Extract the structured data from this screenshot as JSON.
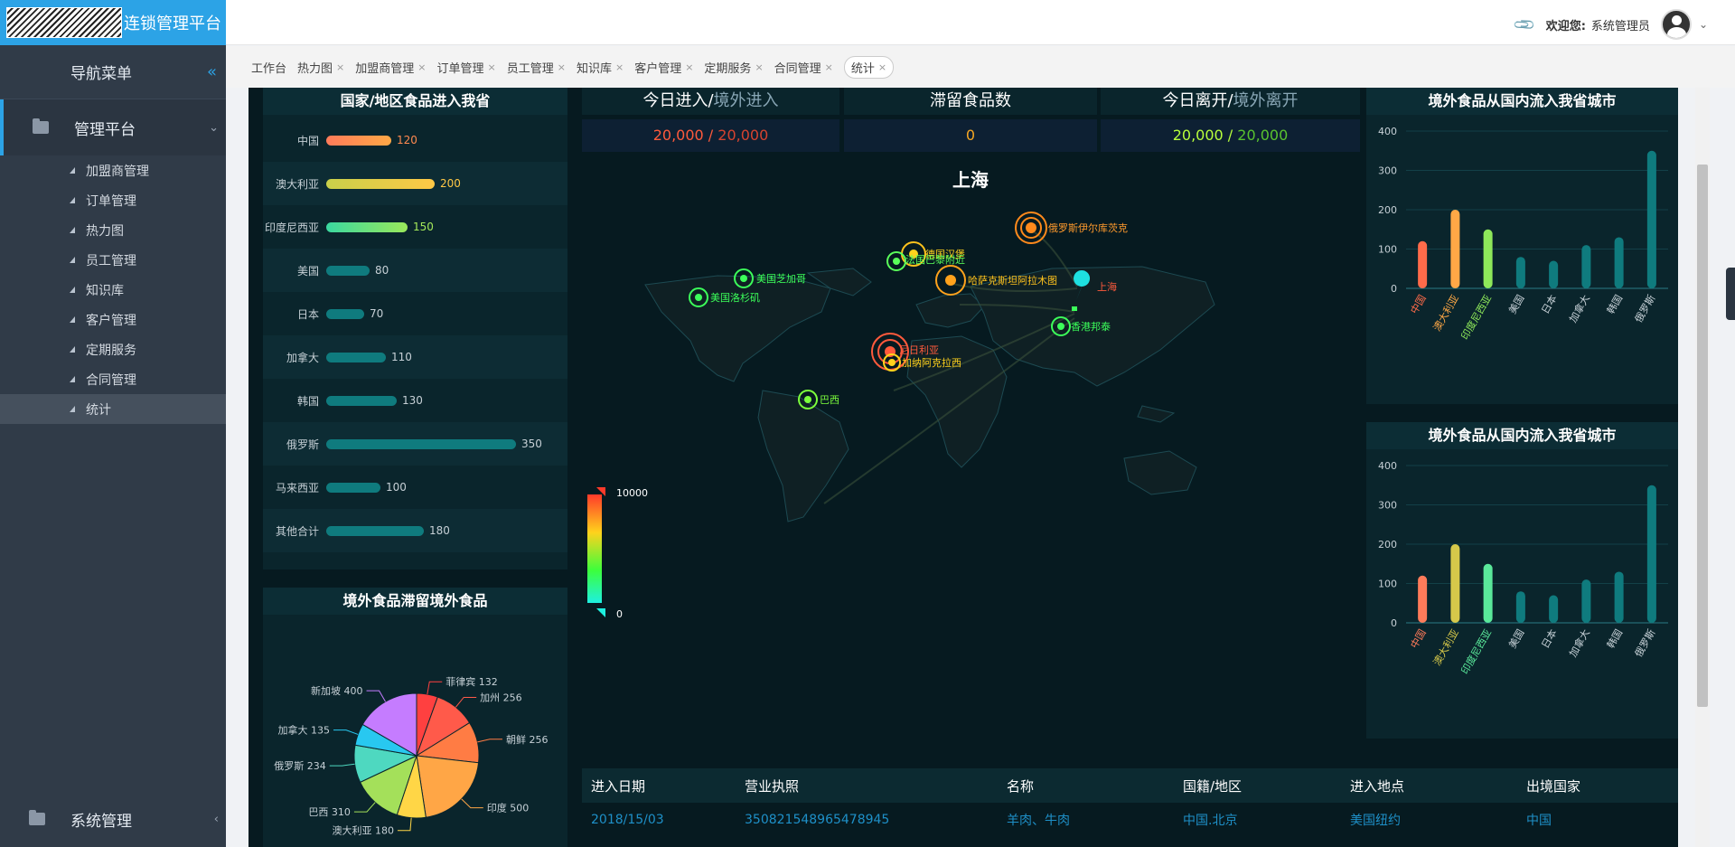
{
  "app": {
    "logo_text": "连锁管理平台",
    "welcome_label": "欢迎您:",
    "user_name": "系统管理员"
  },
  "sidebar": {
    "nav_title": "导航菜单",
    "collapse_icon": "double-chevron-left-icon",
    "group_title": "管理平台",
    "items": [
      {
        "label": "加盟商管理"
      },
      {
        "label": "订单管理"
      },
      {
        "label": "热力图"
      },
      {
        "label": "员工管理"
      },
      {
        "label": "知识库"
      },
      {
        "label": "客户管理"
      },
      {
        "label": "定期服务"
      },
      {
        "label": "合同管理"
      },
      {
        "label": "统计"
      }
    ],
    "bottom_group": "系统管理"
  },
  "tabs": [
    {
      "label": "工作台"
    },
    {
      "label": "热力图"
    },
    {
      "label": "加盟商管理"
    },
    {
      "label": "订单管理"
    },
    {
      "label": "员工管理"
    },
    {
      "label": "知识库"
    },
    {
      "label": "客户管理"
    },
    {
      "label": "定期服务"
    },
    {
      "label": "合同管理"
    },
    {
      "label": "统计"
    }
  ],
  "colors": {
    "accent": "#2ca3e6",
    "dash_bg": "#061a20"
  },
  "dashboard": {
    "left_bar_title": "国家/地区食品进入我省",
    "pie_title": "境外食品滞留境外食品",
    "stats": {
      "enter_title": "今日进入/",
      "enter_title_alt": "境外进入",
      "enter_value": "20,000",
      "enter_value_alt": "20,000",
      "stay_title": "滞留食品数",
      "stay_value": "0",
      "leave_title": "今日离开/",
      "leave_title_alt": "境外离开",
      "leave_value": "20,000",
      "leave_value_alt": "20,000",
      "sep": " / "
    },
    "map": {
      "title": "上海",
      "legend_max": "10000",
      "legend_min": "0",
      "cities": [
        "俄罗斯伊尔库茨克",
        "德国汉堡",
        "法国巴黎附近",
        "美国芝加哥",
        "美国洛杉矶",
        "哈萨克斯坦阿拉木图",
        "上海",
        "香港邦泰",
        "尼日利亚",
        "加纳阿克拉西",
        "巴西"
      ]
    },
    "right_title_1": "境外食品从国内流入我省城市",
    "right_title_2": "境外食品从国内流入我省城市",
    "table": {
      "headers": [
        "进入日期",
        "营业执照",
        "名称",
        "国籍/地区",
        "进入地点",
        "出境国家"
      ],
      "rows": [
        [
          "2018/15/03",
          "350821548965478945",
          "羊肉、牛肉",
          "中国.北京",
          "美国纽约",
          "中国"
        ]
      ]
    }
  },
  "chart_data": [
    {
      "type": "bar",
      "orientation": "horizontal",
      "title": "国家/地区食品进入我省",
      "categories": [
        "中国",
        "澳大利亚",
        "印度尼西亚",
        "美国",
        "日本",
        "加拿大",
        "韩国",
        "俄罗斯",
        "马来西亚",
        "其他合计"
      ],
      "values": [
        120,
        200,
        150,
        80,
        70,
        110,
        130,
        350,
        100,
        180
      ]
    },
    {
      "type": "pie",
      "title": "境外食品滞留境外食品",
      "labels": [
        "菲律宾",
        "加州",
        "朝鲜",
        "印度",
        "澳大利亚",
        "巴西",
        "俄罗斯",
        "加拿大",
        "新加坡"
      ],
      "values": [
        132,
        256,
        256,
        500,
        180,
        310,
        234,
        135,
        400
      ],
      "colors": [
        "#ff4040",
        "#ff5a4a",
        "#ff7c44",
        "#ffa646",
        "#ffd646",
        "#a4e05a",
        "#4ed8c0",
        "#28c8f0",
        "#c57cff"
      ]
    },
    {
      "type": "bar",
      "title": "境外食品从国内流入我省城市",
      "categories": [
        "中国",
        "澳大利亚",
        "印度尼西亚",
        "美国",
        "日本",
        "加拿大",
        "韩国",
        "俄罗斯"
      ],
      "values": [
        120,
        200,
        150,
        80,
        70,
        110,
        130,
        350
      ],
      "ylim": [
        0,
        400
      ],
      "yticks": [
        0,
        100,
        200,
        300,
        400
      ]
    },
    {
      "type": "bar",
      "title": "境外食品从国内流入我省城市",
      "categories": [
        "中国",
        "澳大利亚",
        "印度尼西亚",
        "美国",
        "日本",
        "加拿大",
        "韩国",
        "俄罗斯"
      ],
      "values": [
        120,
        200,
        150,
        80,
        70,
        110,
        130,
        350
      ],
      "ylim": [
        0,
        400
      ],
      "yticks": [
        0,
        100,
        200,
        300,
        400
      ]
    }
  ]
}
